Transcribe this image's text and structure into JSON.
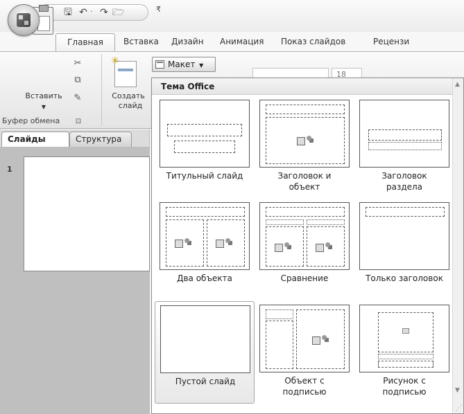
{
  "qat": {
    "save_icon": "save-icon",
    "undo_icon": "undo-icon",
    "redo_icon": "redo-icon",
    "open_icon": "open-icon",
    "dropdown_icon": "customize-qat-icon"
  },
  "tabs": [
    {
      "label": "Главная",
      "active": true
    },
    {
      "label": "Вставка"
    },
    {
      "label": "Дизайн"
    },
    {
      "label": "Анимация"
    },
    {
      "label": "Показ слайдов"
    },
    {
      "label": "Рецензи"
    }
  ],
  "ribbon": {
    "paste_label": "Вставить",
    "clipboard_group": "Буфер обмена",
    "new_slide_label_1": "Создать",
    "new_slide_label_2": "слайд",
    "layout_label": "Макет",
    "font_size": "18"
  },
  "pane": {
    "tabs": [
      "Слайды",
      "Структура"
    ],
    "slide_number": "1"
  },
  "gallery": {
    "header": "Тема Office",
    "layouts": [
      {
        "line1": "Титульный слайд",
        "line2": ""
      },
      {
        "line1": "Заголовок и",
        "line2": "объект"
      },
      {
        "line1": "Заголовок",
        "line2": "раздела"
      },
      {
        "line1": "Два объекта",
        "line2": ""
      },
      {
        "line1": "Сравнение",
        "line2": ""
      },
      {
        "line1": "Только заголовок",
        "line2": ""
      },
      {
        "line1": "Пустой слайд",
        "line2": "",
        "selected": true
      },
      {
        "line1": "Объект с",
        "line2": "подписью"
      },
      {
        "line1": "Рисунок с",
        "line2": "подписью"
      }
    ]
  }
}
